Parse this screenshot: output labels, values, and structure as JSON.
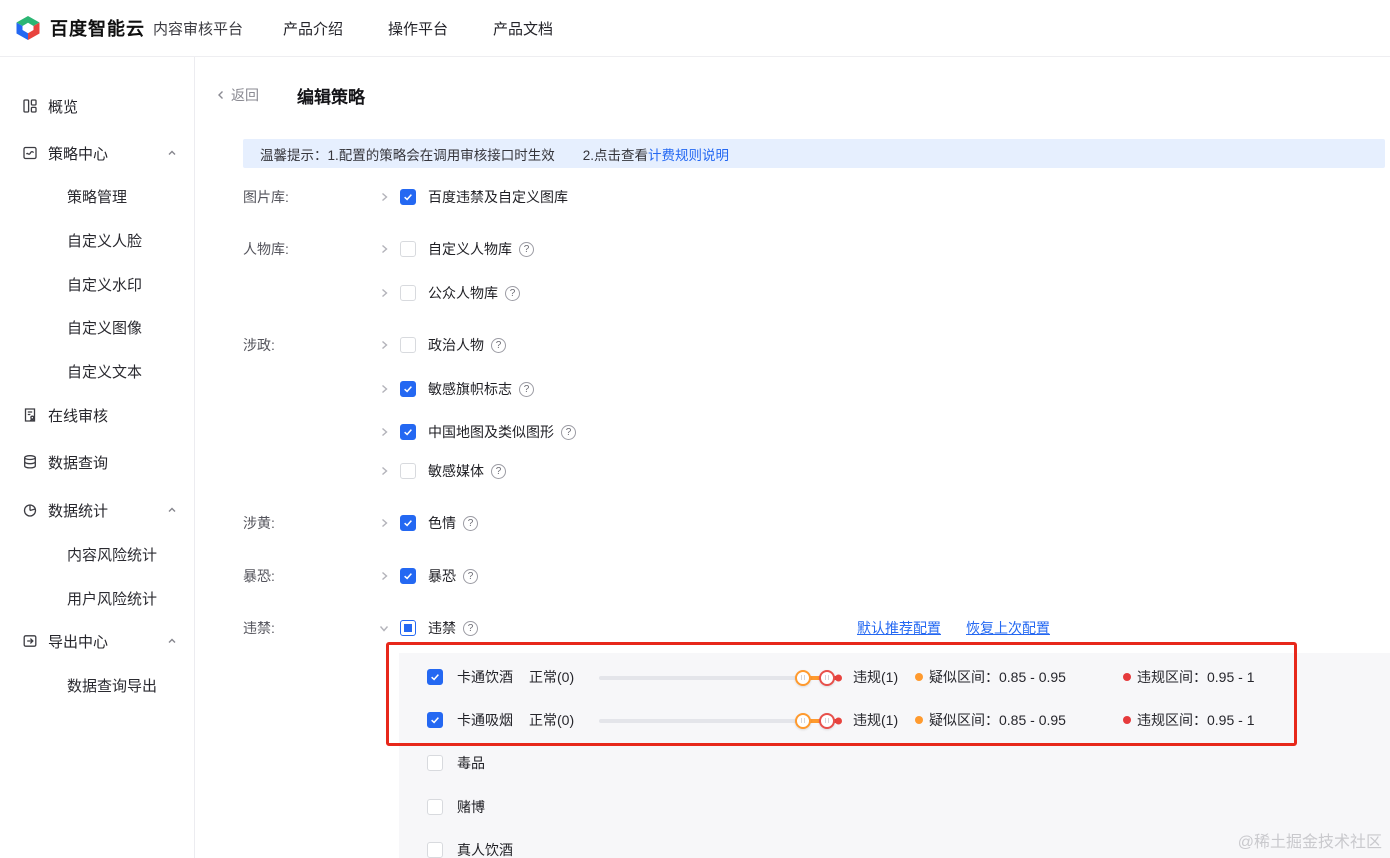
{
  "colors": {
    "accent": "#2468f2",
    "suspect_orange": "#ff9a2e",
    "violation_red": "#e6393c",
    "highlight_red": "#e7281b",
    "notice_bg": "#e6effe"
  },
  "header": {
    "brand": "百度智能云",
    "product": "内容审核平台",
    "nav": [
      {
        "label": "产品介绍"
      },
      {
        "label": "操作平台"
      },
      {
        "label": "产品文档"
      }
    ]
  },
  "sidebar": {
    "items": [
      {
        "label": "概览",
        "icon": "overview-icon"
      },
      {
        "label": "策略中心",
        "icon": "strategy-icon",
        "expanded": true,
        "children": [
          "策略管理",
          "自定义人脸",
          "自定义水印",
          "自定义图像",
          "自定义文本"
        ]
      },
      {
        "label": "在线审核",
        "icon": "review-icon"
      },
      {
        "label": "数据查询",
        "icon": "query-icon"
      },
      {
        "label": "数据统计",
        "icon": "stats-icon",
        "expanded": true,
        "children": [
          "内容风险统计",
          "用户风险统计"
        ]
      },
      {
        "label": "导出中心",
        "icon": "export-icon",
        "expanded": true,
        "children": [
          "数据查询导出"
        ]
      }
    ]
  },
  "page": {
    "back_label": "返回",
    "title": "编辑策略"
  },
  "notice": {
    "part1": "温馨提示：1.配置的策略会在调用审核接口时生效",
    "part2": "2.点击查看",
    "link": "计费规则说明"
  },
  "form": {
    "rows": [
      {
        "section": "图片库:",
        "label": "百度违禁及自定义图库",
        "checked": true,
        "help": false
      },
      {
        "section": "人物库:",
        "label": "自定义人物库",
        "checked": false,
        "help": true
      },
      {
        "section": "",
        "label": "公众人物库",
        "checked": false,
        "help": true
      },
      {
        "section": "涉政:",
        "label": "政治人物",
        "checked": false,
        "help": true
      },
      {
        "section": "",
        "label": "敏感旗帜标志",
        "checked": true,
        "help": true
      },
      {
        "section": "",
        "label": "中国地图及类似图形",
        "checked": true,
        "help": true
      },
      {
        "section": "",
        "label": "敏感媒体",
        "checked": false,
        "help": true
      },
      {
        "section": "涉黄:",
        "label": "色情",
        "checked": true,
        "help": true
      },
      {
        "section": "暴恐:",
        "label": "暴恐",
        "checked": true,
        "help": true
      }
    ],
    "weijin": {
      "section": "违禁:",
      "label": "违禁",
      "state": "indeterminate",
      "links": [
        {
          "label": "默认推荐配置"
        },
        {
          "label": "恢复上次配置"
        }
      ]
    },
    "more_rows": [
      "毒品",
      "赌博",
      "真人饮酒"
    ]
  },
  "sliders": {
    "rows": [
      {
        "checked": true,
        "label": "卡通饮酒",
        "min_label": "正常(0)",
        "max_label": "违规(1)",
        "suspect_label": "疑似区间：0.85 - 0.95",
        "violation_label": "违规区间：0.95 - 1",
        "suspect_start": 0.85,
        "violation_start": 0.95,
        "max": 1
      },
      {
        "checked": true,
        "label": "卡通吸烟",
        "min_label": "正常(0)",
        "max_label": "违规(1)",
        "suspect_label": "疑似区间：0.85 - 0.95",
        "violation_label": "违规区间：0.95 - 1",
        "suspect_start": 0.85,
        "violation_start": 0.95,
        "max": 1
      }
    ]
  },
  "watermark": "@稀土掘金技术社区"
}
